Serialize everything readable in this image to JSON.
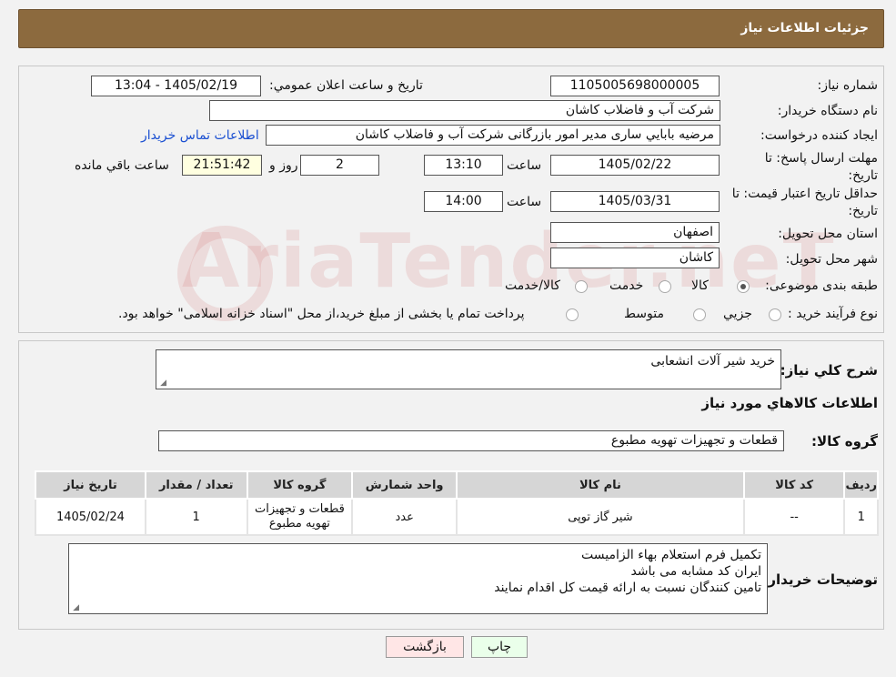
{
  "header": {
    "title": "جزئیات اطلاعات نیاز"
  },
  "form": {
    "need_number": {
      "label": "شماره نیاز:",
      "value": "1105005698000005"
    },
    "announce_datetime": {
      "label": "تاریخ و ساعت اعلان عمومي:",
      "value": "1405/02/19 - 13:04"
    },
    "buyer_org": {
      "label": "نام دستگاه خريدار:",
      "value": "شركت آب و فاضلاب كاشان"
    },
    "requester": {
      "label": "ايجاد كننده درخواست:",
      "value": "مرضيه بابايي ساری مدير امور بازرگانی شركت آب و فاضلاب كاشان",
      "contact_link": "اطلاعات تماس خريدار"
    },
    "deadline": {
      "label": "مهلت ارسال پاسخ: تا تاريخ:",
      "date": "1405/02/22",
      "time_label": "ساعت",
      "time": "13:10",
      "days": "2",
      "days_label": "روز و",
      "remaining": "21:51:42",
      "remaining_label": "ساعت باقي مانده"
    },
    "price_validity": {
      "label": "حداقل تاريخ اعتبار قيمت: تا تاريخ:",
      "date": "1405/03/31",
      "time_label": "ساعت",
      "time": "14:00"
    },
    "province": {
      "label": "استان محل تحويل:",
      "value": "اصفهان"
    },
    "city": {
      "label": "شهر محل تحويل:",
      "value": "كاشان"
    },
    "category": {
      "label": "طبقه بندی موضوعی:",
      "options": [
        "كالا",
        "خدمت",
        "كالا/خدمت"
      ],
      "selected": "كالا"
    },
    "process_type": {
      "label": "نوع فرآيند خريد :",
      "options": [
        "جزيي",
        "متوسط"
      ],
      "note": "پرداخت تمام يا بخشی از مبلغ خريد،از محل \"اسناد خزانه اسلامی\" خواهد بود."
    }
  },
  "watermark": "AriaTender.neT",
  "summary": {
    "label": "شرح كلي نياز:",
    "value": "خريد شير آلات انشعابی",
    "items_title": "اطلاعات كالاهاي مورد نياز",
    "group_label": "گروه كالا:",
    "group_value": "قطعات و تجهيزات تهويه مطبوع"
  },
  "table": {
    "headers": [
      "رديف",
      "كد كالا",
      "نام كالا",
      "واحد شمارش",
      "گروه كالا",
      "تعداد / مقدار",
      "تاريخ نياز"
    ],
    "rows": [
      [
        "1",
        "--",
        "شير گاز توپی",
        "عدد",
        "قطعات و تجهيزات تهويه مطبوع",
        "1",
        "1405/02/24"
      ]
    ]
  },
  "buyer_notes": {
    "label": "توضيحات خريدار:",
    "lines": [
      "تكميل فرم استعلام بهاء الزاميست",
      "ايران كد مشابه می باشد",
      "تامين كنندگان نسبت به ارائه قيمت كل اقدام نمايند"
    ]
  },
  "buttons": {
    "print": "چاپ",
    "back": "بازگشت"
  },
  "colors": {
    "header_bg": "#8c6a3e",
    "link": "#1a4fd1",
    "print_bg": "#eaffea",
    "back_bg": "#ffe6e6",
    "timer_bg": "#ffffe0"
  }
}
